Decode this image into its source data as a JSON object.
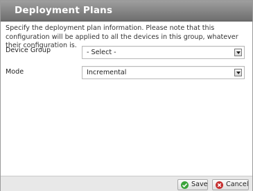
{
  "dialog": {
    "title": "Deployment Plans",
    "description": "Specify the deployment plan information. Please note that this configuration will be applied to all the devices in this group, whatever their configuration is."
  },
  "fields": {
    "device_group": {
      "label": "Device Group",
      "value": "- Select -"
    },
    "mode": {
      "label": "Mode",
      "value": "Incremental"
    }
  },
  "footer": {
    "save_label": "Save",
    "cancel_label": "Cancel"
  },
  "icons": {
    "save": "check-circle-icon",
    "cancel": "x-circle-icon",
    "dropdown": "chevron-down-icon"
  },
  "colors": {
    "titlebar": "#8a8a8a",
    "save_icon": "#3aa33a",
    "cancel_icon": "#c63030"
  }
}
